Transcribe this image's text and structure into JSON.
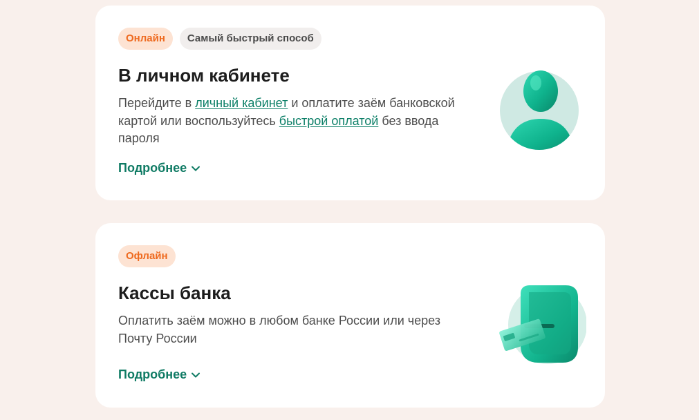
{
  "cards": [
    {
      "tags": [
        "Онлайн",
        "Самый быстрый способ"
      ],
      "title": "В личном кабинете",
      "text_parts": {
        "t1": "Перейдите в ",
        "link1": "личный кабинет",
        "t2": " и оплатите заём банковской картой или воспользуйтесь ",
        "link2": "быстрой оплатой",
        "t3": " без ввода пароля"
      },
      "more_label": "Подробнее",
      "icon": "user-avatar-icon"
    },
    {
      "tags": [
        "Офлайн"
      ],
      "title": "Кассы банка",
      "text": "Оплатить заём можно в любом банке России или через Почту России",
      "more_label": "Подробнее",
      "icon": "atm-card-icon"
    }
  ],
  "colors": {
    "page_bg": "#f9f0ec",
    "card_bg": "#ffffff",
    "accent_green": "#0f7b64",
    "tag_orange_bg": "#fde3d3",
    "tag_orange_text": "#ee6a1f",
    "tag_gray_bg": "#f1eeed"
  }
}
